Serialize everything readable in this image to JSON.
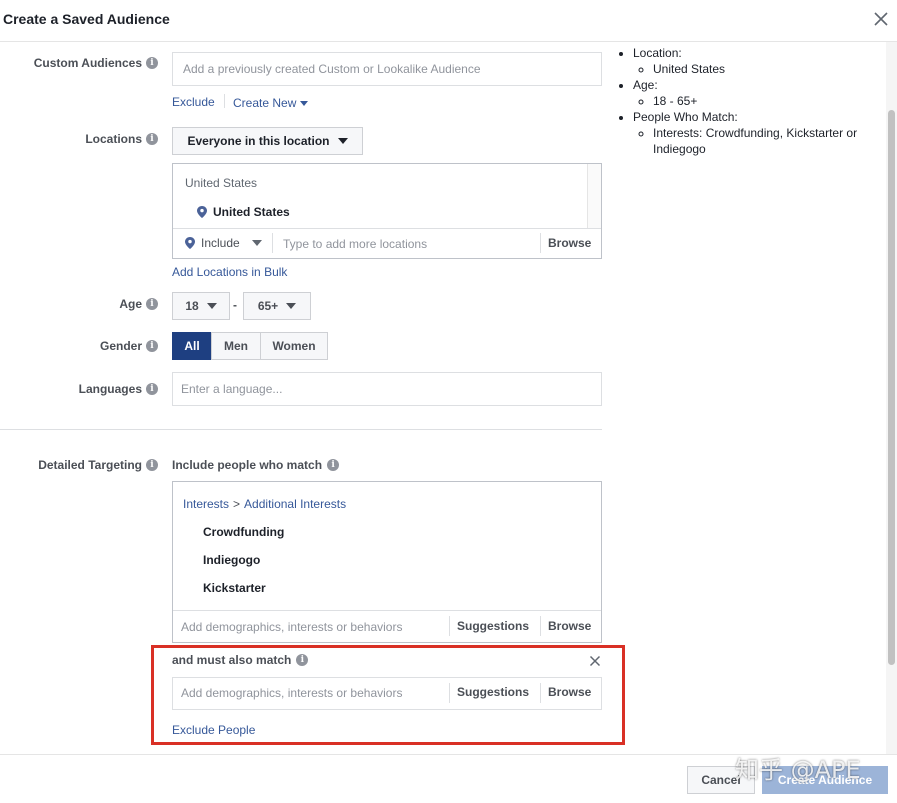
{
  "dialog": {
    "title": "Create a Saved Audience"
  },
  "custom_audiences": {
    "label": "Custom Audiences",
    "placeholder": "Add a previously created Custom or Lookalike Audience",
    "exclude": "Exclude",
    "create_new": "Create New"
  },
  "locations": {
    "label": "Locations",
    "dropdown": "Everyone in this location",
    "group_title": "United States",
    "selected": "United States",
    "include": "Include",
    "placeholder": "Type to add more locations",
    "browse": "Browse",
    "bulk_link": "Add Locations in Bulk"
  },
  "age": {
    "label": "Age",
    "min": "18",
    "dash": "-",
    "max": "65+"
  },
  "gender": {
    "label": "Gender",
    "options": [
      "All",
      "Men",
      "Women"
    ],
    "selected": "All"
  },
  "languages": {
    "label": "Languages",
    "placeholder": "Enter a language..."
  },
  "detailed_targeting": {
    "label": "Detailed Targeting",
    "include_title": "Include people who match",
    "crumb_root": "Interests",
    "crumb_sep": ">",
    "crumb_child": "Additional Interests",
    "interests": [
      "Crowdfunding",
      "Indiegogo",
      "Kickstarter"
    ],
    "placeholder": "Add demographics, interests or behaviors",
    "suggestions": "Suggestions",
    "browse": "Browse",
    "must_match_title": "and must also match",
    "must_placeholder": "Add demographics, interests or behaviors",
    "must_suggestions": "Suggestions",
    "must_browse": "Browse",
    "exclude_people": "Exclude People"
  },
  "summary": {
    "location_label": "Location:",
    "location_value": "United States",
    "age_label": "Age:",
    "age_value": "18 - 65+",
    "match_label": "People Who Match:",
    "match_value": "Interests: Crowdfunding, Kickstarter or Indiegogo"
  },
  "footer": {
    "cancel": "Cancel",
    "create": "Create Audience",
    "watermark": "知乎 @APE"
  },
  "colors": {
    "highlight_border": "#d93025",
    "primary": "#4267b2",
    "primary_disabled": "#9cb4d8",
    "link": "#365899"
  }
}
